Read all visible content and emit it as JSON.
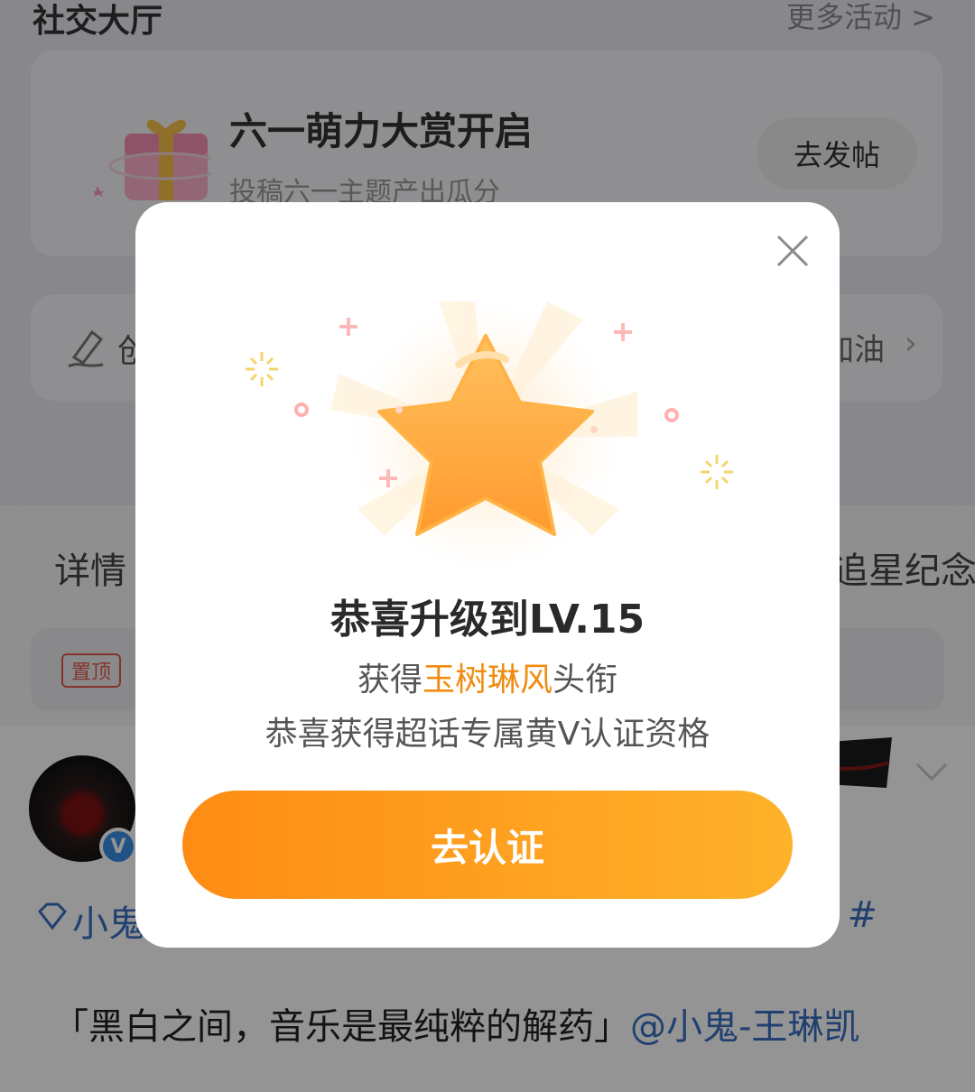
{
  "background": {
    "section_title": "社交大厅",
    "more_link": "更多活动 >",
    "event": {
      "title": "六一萌力大赏开启",
      "subtitle": "投稿六一主题产出瓜分",
      "button": "去发帖"
    },
    "create": {
      "label": "创",
      "cheer": "加油"
    },
    "tabs": {
      "detail": "详情",
      "memorial": "追星纪念"
    },
    "pinned_badge": "置顶",
    "post": {
      "topic_name": "小鬼",
      "topic_end": "#",
      "text": "「黑白之间，音乐是最纯粹的解药」",
      "mention": "@小鬼-王琳凯"
    }
  },
  "dialog": {
    "title": "恭喜升级到LV.15",
    "obtain_prefix": "获得",
    "title_name": "玉树琳风",
    "obtain_suffix": "头衔",
    "qualification": "恭喜获得超话专属黄V认证资格",
    "cta": "去认证"
  },
  "colors": {
    "accent_orange": "#f08c10",
    "cta_start": "#fe8c14",
    "cta_end": "#feb22a",
    "link_blue": "#3a6fbf",
    "pin_red": "#e65b4a",
    "verified_blue": "#3a8ee6"
  },
  "icons": [
    "gift-icon",
    "edit-pen-icon",
    "chevron-right-icon",
    "verified-icon",
    "diamond-icon",
    "chevron-down-icon",
    "close-icon",
    "star-icon"
  ]
}
